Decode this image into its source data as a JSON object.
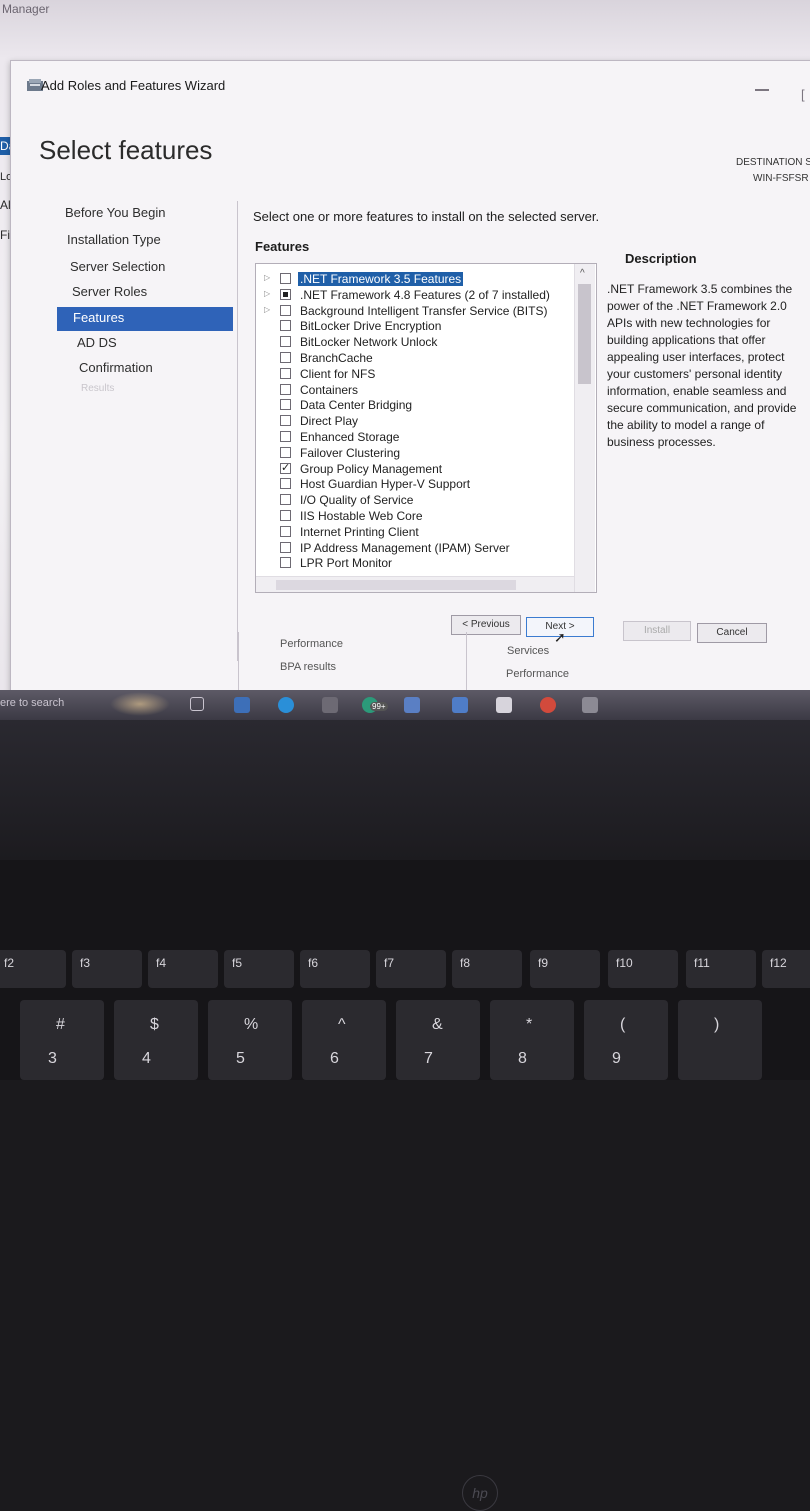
{
  "background": {
    "title": "Manager",
    "side_labels": [
      "Das",
      "Loc",
      "All",
      "File"
    ],
    "search_hint": "ere to search",
    "tiles": {
      "performance_1": "Performance",
      "bpa": "BPA results",
      "services": "Services",
      "performance_2": "Performance"
    }
  },
  "wizard": {
    "title": "Add Roles and Features Wizard",
    "heading": "Select features",
    "destination_label": "DESTINATION S",
    "destination_server": "WIN-FSFSR",
    "nav": [
      {
        "label": "Before You Begin"
      },
      {
        "label": "Installation Type"
      },
      {
        "label": "Server Selection"
      },
      {
        "label": "Server Roles"
      },
      {
        "label": "Features",
        "active": true
      },
      {
        "label": "AD DS"
      },
      {
        "label": "Confirmation"
      },
      {
        "label": "Results",
        "disabled": true
      }
    ],
    "instruction": "Select one or more features to install on the selected server.",
    "features_label": "Features",
    "features": [
      {
        "label": ".NET Framework 3.5 Features",
        "expandable": true,
        "state": "unchecked",
        "selected": true
      },
      {
        "label": ".NET Framework 4.8 Features (2 of 7 installed)",
        "expandable": true,
        "state": "partial"
      },
      {
        "label": "Background Intelligent Transfer Service (BITS)",
        "expandable": true,
        "state": "unchecked"
      },
      {
        "label": "BitLocker Drive Encryption",
        "state": "unchecked"
      },
      {
        "label": "BitLocker Network Unlock",
        "state": "unchecked"
      },
      {
        "label": "BranchCache",
        "state": "unchecked"
      },
      {
        "label": "Client for NFS",
        "state": "unchecked"
      },
      {
        "label": "Containers",
        "state": "unchecked"
      },
      {
        "label": "Data Center Bridging",
        "state": "unchecked"
      },
      {
        "label": "Direct Play",
        "state": "unchecked"
      },
      {
        "label": "Enhanced Storage",
        "state": "unchecked"
      },
      {
        "label": "Failover Clustering",
        "state": "unchecked"
      },
      {
        "label": "Group Policy Management",
        "state": "checked"
      },
      {
        "label": "Host Guardian Hyper-V Support",
        "state": "unchecked"
      },
      {
        "label": "I/O Quality of Service",
        "state": "unchecked"
      },
      {
        "label": "IIS Hostable Web Core",
        "state": "unchecked"
      },
      {
        "label": "Internet Printing Client",
        "state": "unchecked"
      },
      {
        "label": "IP Address Management (IPAM) Server",
        "state": "unchecked"
      },
      {
        "label": "LPR Port Monitor",
        "state": "unchecked"
      }
    ],
    "description_heading": "Description",
    "description_text": ".NET Framework 3.5 combines the power of the .NET Framework 2.0 APIs with new technologies for building applications that offer appealing user interfaces, protect your customers' personal identity information, enable seamless and secure communication, and provide the ability to model a range of business processes.",
    "buttons": {
      "previous": "< Previous",
      "next": "Next >",
      "install": "Install",
      "cancel": "Cancel"
    }
  },
  "taskbar": {
    "badge": "99+"
  },
  "keyboard": {
    "fkeys": [
      "f2",
      "f3",
      "f4",
      "f5",
      "f6",
      "f7",
      "f8",
      "f9",
      "f10",
      "f11",
      "f12"
    ],
    "number_row": [
      "#",
      "3",
      "$",
      "4",
      "%",
      "5",
      "^",
      "6",
      "&",
      "7",
      "*",
      "8",
      "(",
      "9",
      ")"
    ]
  },
  "colors": {
    "accent": "#2f63b8",
    "selection": "#1f5fa8",
    "taskbar": "#4a4854"
  }
}
